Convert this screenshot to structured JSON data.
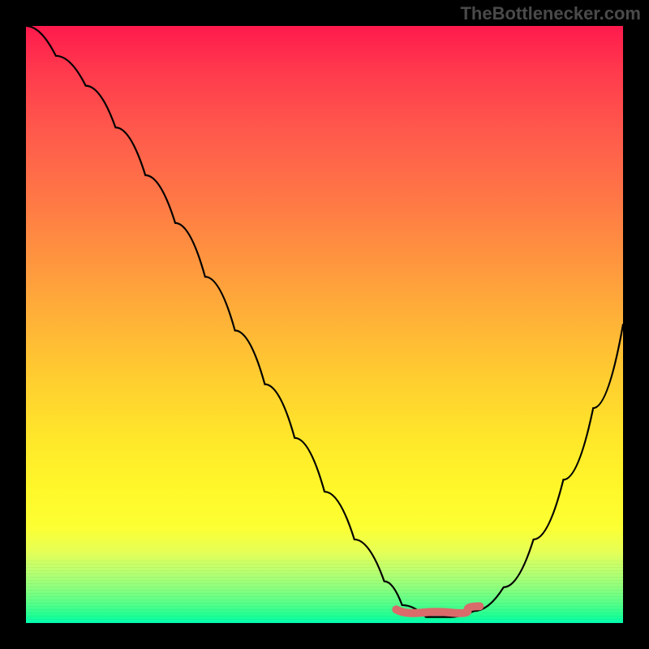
{
  "watermark": "TheBottlenecker.com",
  "chart_data": {
    "type": "line",
    "title": "",
    "xlabel": "",
    "ylabel": "",
    "xlim": [
      0,
      100
    ],
    "ylim": [
      0,
      100
    ],
    "series": [
      {
        "name": "curve",
        "x": [
          0,
          5,
          10,
          15,
          20,
          25,
          30,
          35,
          40,
          45,
          50,
          55,
          60,
          63,
          67,
          71,
          75,
          80,
          85,
          90,
          95,
          100
        ],
        "values": [
          100,
          95,
          90,
          83,
          75,
          67,
          58,
          49,
          40,
          31,
          22,
          14,
          7,
          3,
          1,
          1,
          2,
          6,
          14,
          24,
          36,
          50
        ]
      }
    ],
    "flat_segment": {
      "x_start": 62,
      "x_end": 76,
      "y": 2
    },
    "colors": {
      "gradient_top": "#ff1a4d",
      "gradient_mid": "#ffe92a",
      "gradient_bottom": "#00ffb4",
      "curve": "#000000",
      "flat_highlight": "#d96b6b",
      "frame": "#000000"
    }
  }
}
